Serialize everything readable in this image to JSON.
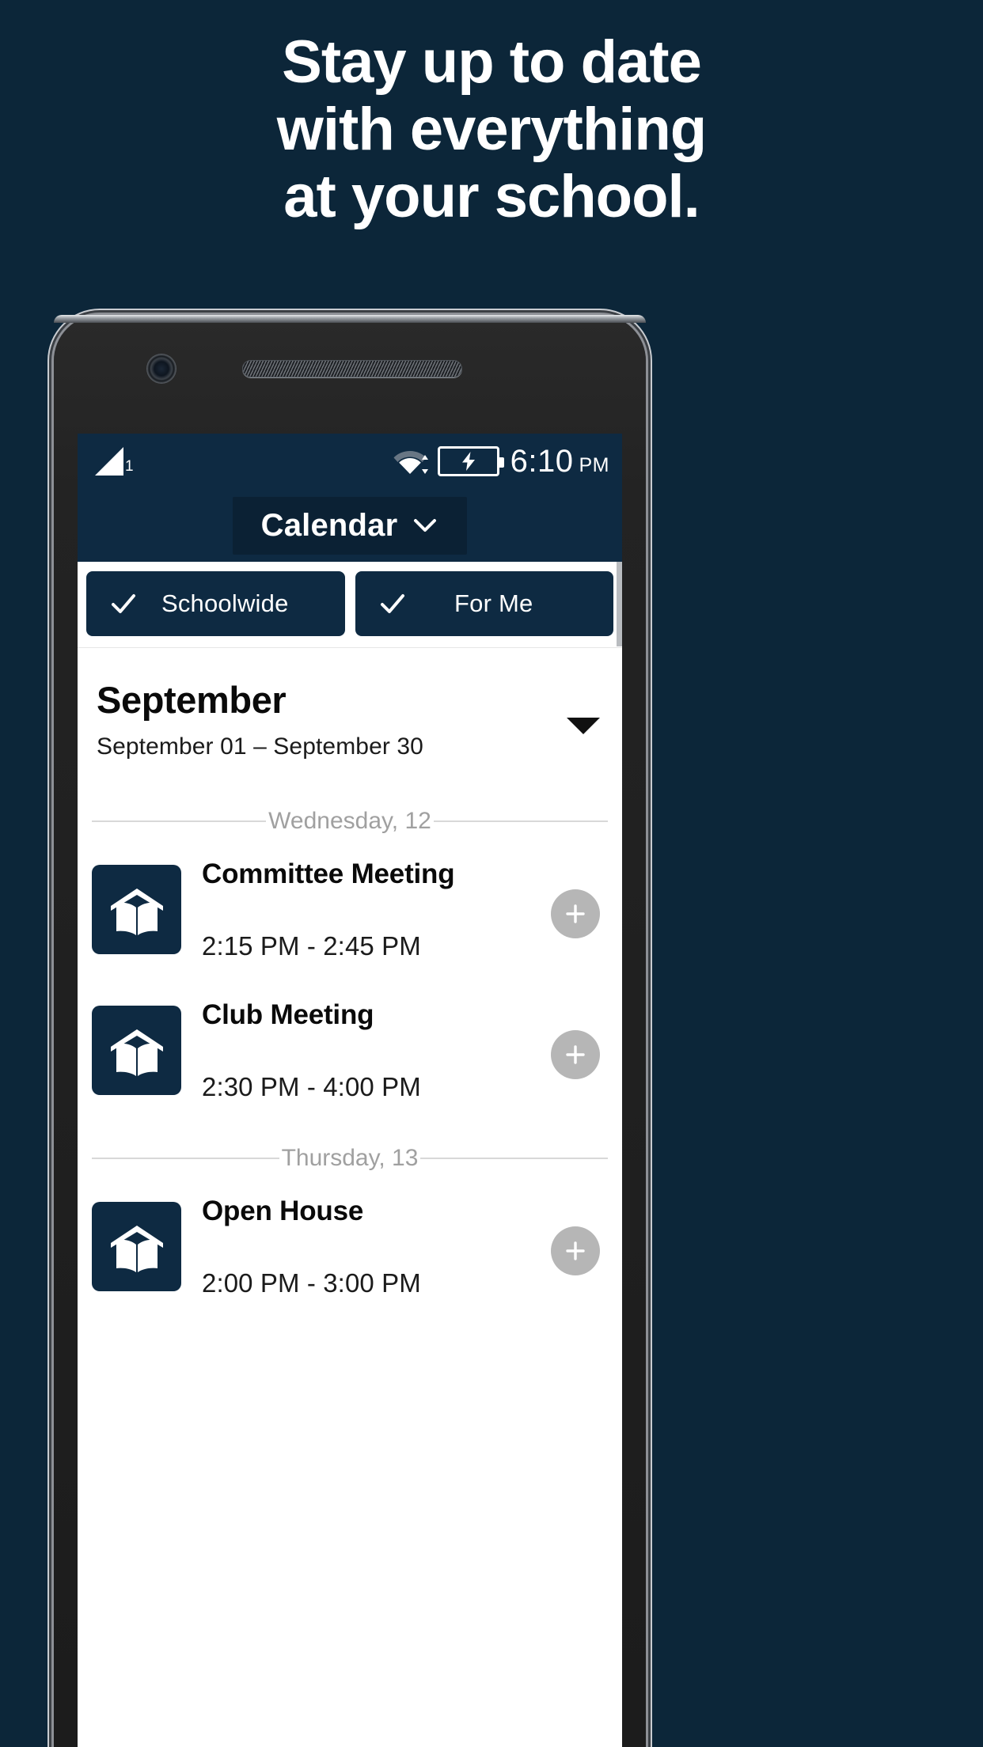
{
  "marketing": {
    "headline_lines": [
      "Stay up to date",
      "with everything",
      "at your school."
    ],
    "background_color": "#0c2639",
    "text_color": "#ffffff"
  },
  "device": {
    "status_bar": {
      "signal_icon": "signal-bars-icon",
      "sim_indicator": "1",
      "wifi_icon": "wifi-icon",
      "battery_icon": "battery-charging-icon",
      "time": "6:10",
      "am_pm": "PM",
      "background_color": "#0e2a42"
    },
    "app_bar": {
      "title": "Calendar",
      "dropdown_icon": "chevron-down-icon"
    }
  },
  "filters": [
    {
      "label": "Schoolwide",
      "checked": true,
      "check_icon": "check-icon"
    },
    {
      "label": "For Me",
      "checked": true,
      "check_icon": "check-icon"
    }
  ],
  "month_header": {
    "title": "September",
    "range": "September 01 – September 30",
    "expand_icon": "caret-down-icon"
  },
  "days": [
    {
      "label": "Wednesday, 12",
      "events": [
        {
          "icon": "school-book-icon",
          "title": "Committee Meeting",
          "time": "2:15 PM - 2:45 PM",
          "add_icon": "plus-icon"
        },
        {
          "icon": "school-book-icon",
          "title": "Club Meeting",
          "time": "2:30 PM - 4:00 PM",
          "add_icon": "plus-icon"
        }
      ]
    },
    {
      "label": "Thursday, 13",
      "events": [
        {
          "icon": "school-book-icon",
          "title": "Open House",
          "time": "2:00 PM - 3:00 PM",
          "add_icon": "plus-icon"
        }
      ]
    }
  ],
  "colors": {
    "brand_navy": "#0e2a42",
    "page_background": "#0c2639",
    "chip_background": "#0e2a42",
    "add_button": "#b6b6b6",
    "divider": "#d8d8d8"
  }
}
